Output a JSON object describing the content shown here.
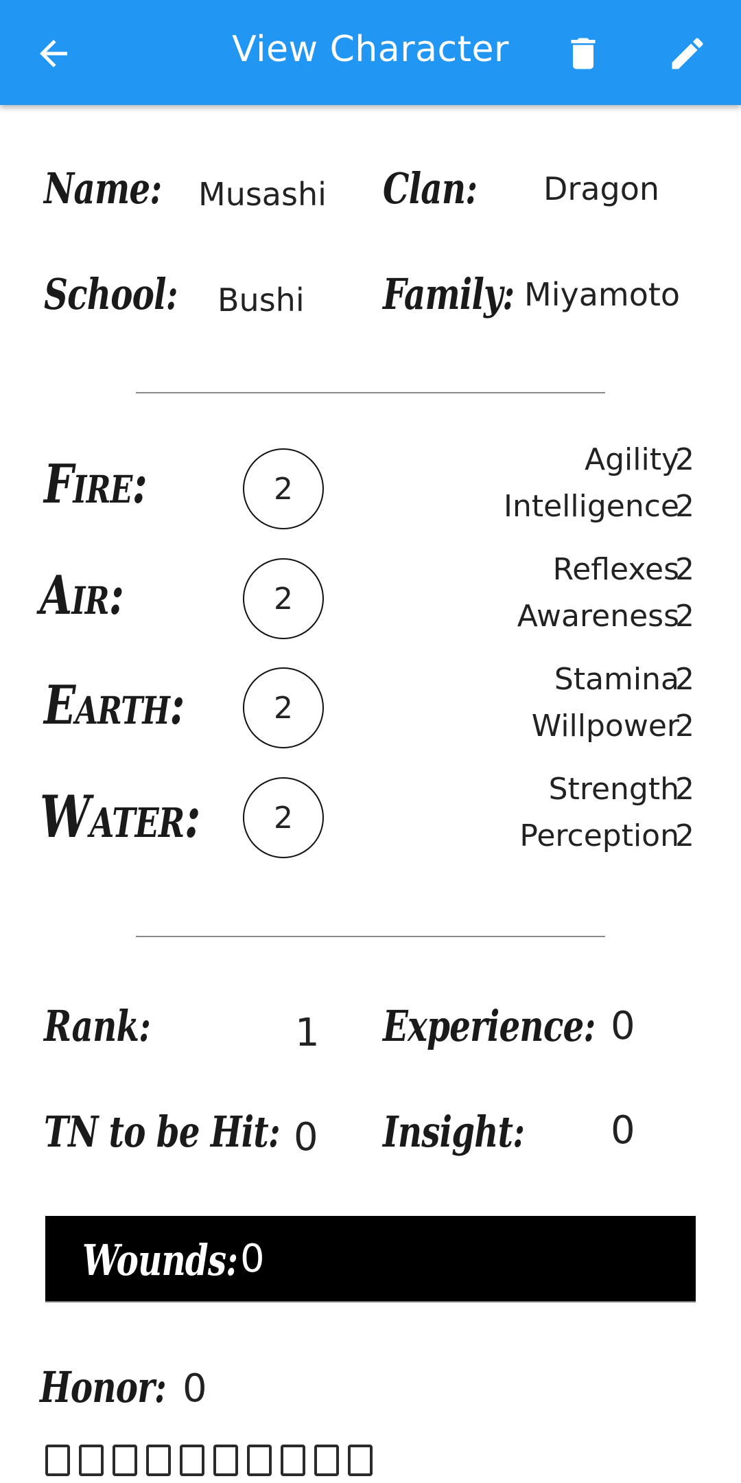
{
  "appbar": {
    "title": "View Character",
    "back_icon": "arrow-left-icon",
    "delete_icon": "trash-icon",
    "edit_icon": "pencil-icon",
    "color": "#2196F3"
  },
  "identity": {
    "name_label": "Name:",
    "name_value": "Musashi",
    "clan_label": "Clan:",
    "clan_value": "Dragon",
    "school_label": "School:",
    "school_value": "Bushi",
    "family_label": "Family:",
    "family_value": "Miyamoto"
  },
  "rings": [
    {
      "label": "Fire:",
      "value": "2",
      "traits": [
        {
          "name": "Agility",
          "value": "2"
        },
        {
          "name": "Intelligence",
          "value": "2"
        }
      ]
    },
    {
      "label": "Air:",
      "value": "2",
      "traits": [
        {
          "name": "Reflexes",
          "value": "2"
        },
        {
          "name": "Awareness",
          "value": "2"
        }
      ]
    },
    {
      "label": "Earth:",
      "value": "2",
      "traits": [
        {
          "name": "Stamina",
          "value": "2"
        },
        {
          "name": "Willpower",
          "value": "2"
        }
      ]
    },
    {
      "label": "Water:",
      "value": "2",
      "traits": [
        {
          "name": "Strength",
          "value": "2"
        },
        {
          "name": "Perception",
          "value": "2"
        }
      ]
    }
  ],
  "stats": {
    "rank_label": "Rank:",
    "rank_value": "1",
    "experience_label": "Experience:",
    "experience_value": "0",
    "tn_label": "TN to be Hit:",
    "tn_value": "0",
    "insight_label": "Insight:",
    "insight_value": "0"
  },
  "wounds": {
    "label": "Wounds:",
    "value": "0"
  },
  "honor": {
    "label": "Honor:",
    "value": "0",
    "boxes_total": 10,
    "boxes_checked": 0
  }
}
